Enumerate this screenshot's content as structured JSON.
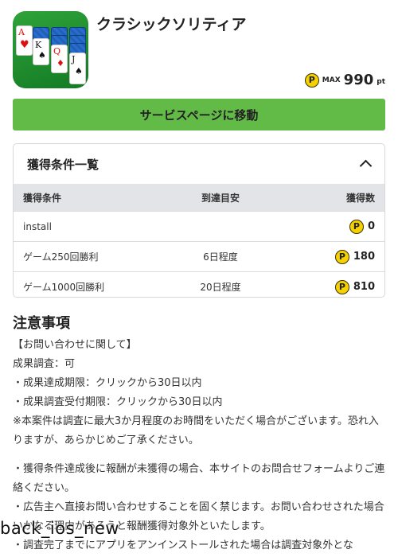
{
  "app": {
    "title": "クラシックソリティア",
    "icon_name": "solitaire-app-icon",
    "cards": {
      "ace": "A",
      "heart": "♥",
      "king": "K",
      "spade": "♠",
      "queen": "Q",
      "diamond": "♦",
      "jack": "J"
    }
  },
  "max_points": {
    "coin": "P",
    "label": "MAX",
    "value": "990",
    "unit": "pt"
  },
  "service_button": {
    "label": "サービスページに移動",
    "color": "#62bb47"
  },
  "conditions": {
    "title": "獲得条件一覧",
    "columns": [
      "獲得条件",
      "到達目安",
      "獲得数"
    ],
    "rows": [
      {
        "condition": "install",
        "eta": "",
        "points": "0"
      },
      {
        "condition": "ゲーム250回勝利",
        "eta": "6日程度",
        "points": "180"
      },
      {
        "condition": "ゲーム1000回勝利",
        "eta": "20日程度",
        "points": "810"
      }
    ]
  },
  "notes": {
    "title": "注意事項",
    "lines": [
      "【お問い合わせに関して】",
      "成果調査：可",
      "・成果達成期限：クリックから30日以内",
      "・成果調査受付期限：クリックから30日以内",
      "※本案件は調査に最大3か月程度のお時間をいただく場合がございます。恐れ入りますが、あらかじめご了承ください。"
    ],
    "lines2": [
      "・獲得条件達成後に報酬が未獲得の場合、本サイトのお問合せフォームよりご連絡ください。",
      "・広告主へ直接お問い合わせすることを固く禁じます。お問い合わせされた場合いかなる理由があろうと報酬獲得対象外といたします。",
      "・調査完了までにアプリをアンインストールされた場合は調査対象外とな"
    ]
  },
  "overlay": "back_ios_new"
}
